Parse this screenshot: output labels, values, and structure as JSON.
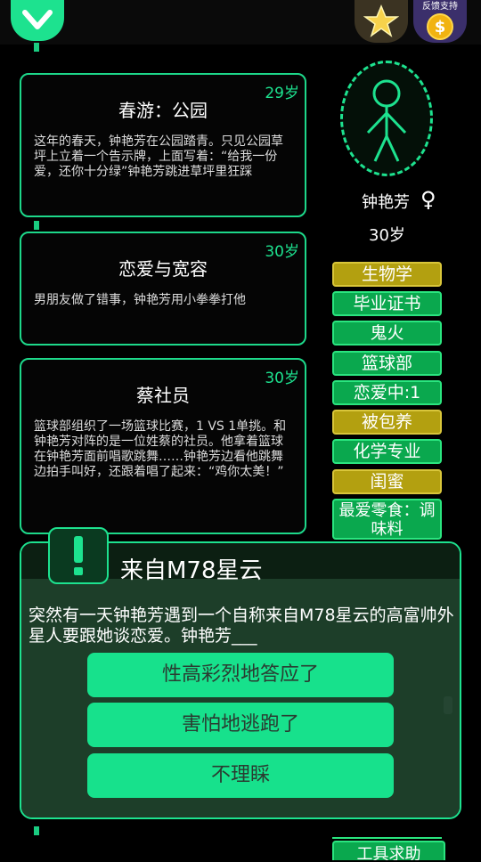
{
  "header": {
    "support_label": "反馈支持"
  },
  "events": [
    {
      "age": "29岁",
      "title": "春游：公园",
      "desc": "这年的春天，钟艳芳在公园踏青。只见公园草坪上立着一个告示牌，上面写着：“给我一份爱，还你十分绿”钟艳芳跳进草坪里狂踩"
    },
    {
      "age": "30岁",
      "title": "恋爱与宽容",
      "desc": "男朋友做了错事，钟艳芳用小拳拳打他"
    },
    {
      "age": "30岁",
      "title": "蔡社员",
      "desc": "篮球部组织了一场篮球比赛，1 VS 1单挑。和钟艳芳对阵的是一位姓蔡的社员。他拿着篮球在钟艳芳面前唱歌跳舞……钟艳芳边看他跳舞边拍手叫好，还跟着唱了起来：“鸡你太美！”"
    }
  ],
  "profile": {
    "name": "钟艳芳",
    "gender_symbol": "♀",
    "age": "30岁"
  },
  "tags": [
    {
      "label": "生物学",
      "color": "gold"
    },
    {
      "label": "毕业证书",
      "color": "green"
    },
    {
      "label": "鬼火",
      "color": "green"
    },
    {
      "label": "篮球部",
      "color": "green"
    },
    {
      "label": "恋爱中:1",
      "color": "green"
    },
    {
      "label": "被包养",
      "color": "gold"
    },
    {
      "label": "化学专业",
      "color": "green"
    },
    {
      "label": "闺蜜",
      "color": "gold"
    },
    {
      "label": "最爱零食：调味料",
      "color": "green"
    }
  ],
  "bottom_tag": "工具求助",
  "dialog": {
    "title": "来自M78星云",
    "question": "突然有一天钟艳芳遇到一个自称来自M78星云的高富帅外星人要跟她谈恋爱。钟艳芳___",
    "options": [
      "性高彩烈地答应了",
      "害怕地逃跑了",
      "不理睬"
    ]
  },
  "colors": {
    "accent": "#1de28f",
    "gold": "#b3a010",
    "tag_green": "#0aa84e"
  }
}
